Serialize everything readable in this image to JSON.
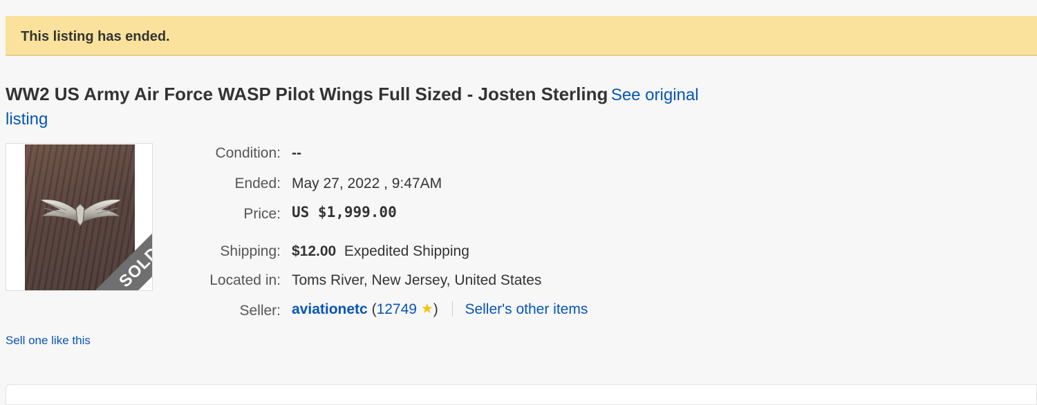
{
  "banner": {
    "message": "This listing has ended."
  },
  "listing": {
    "title": "WW2 US Army Air Force WASP Pilot Wings Full Sized - Josten Sterling",
    "see_original_label": "See original listing",
    "photo_badge": "SOLD"
  },
  "details": {
    "condition": {
      "label": "Condition:",
      "value": "--"
    },
    "ended": {
      "label": "Ended:",
      "value": "May 27, 2022 , 9:47AM"
    },
    "price": {
      "label": "Price:",
      "value": "US $1,999.00"
    },
    "shipping": {
      "label": "Shipping:",
      "cost": "$12.00",
      "method": "Expedited Shipping"
    },
    "location": {
      "label": "Located in:",
      "value": "Toms River, New Jersey, United States"
    },
    "seller": {
      "label": "Seller:",
      "name": "aviationetc",
      "open_paren": "(",
      "feedback_score": "12749",
      "close_paren": ")",
      "other_items_label": "Seller's other items",
      "star_icon": "star-icon",
      "star_color": "#f6c20a"
    }
  },
  "actions": {
    "sell_one_like_this": "Sell one like this"
  },
  "colors": {
    "banner_bg": "#fbe29c",
    "link": "#0654ba",
    "page_bg": "#f7f7f7"
  }
}
